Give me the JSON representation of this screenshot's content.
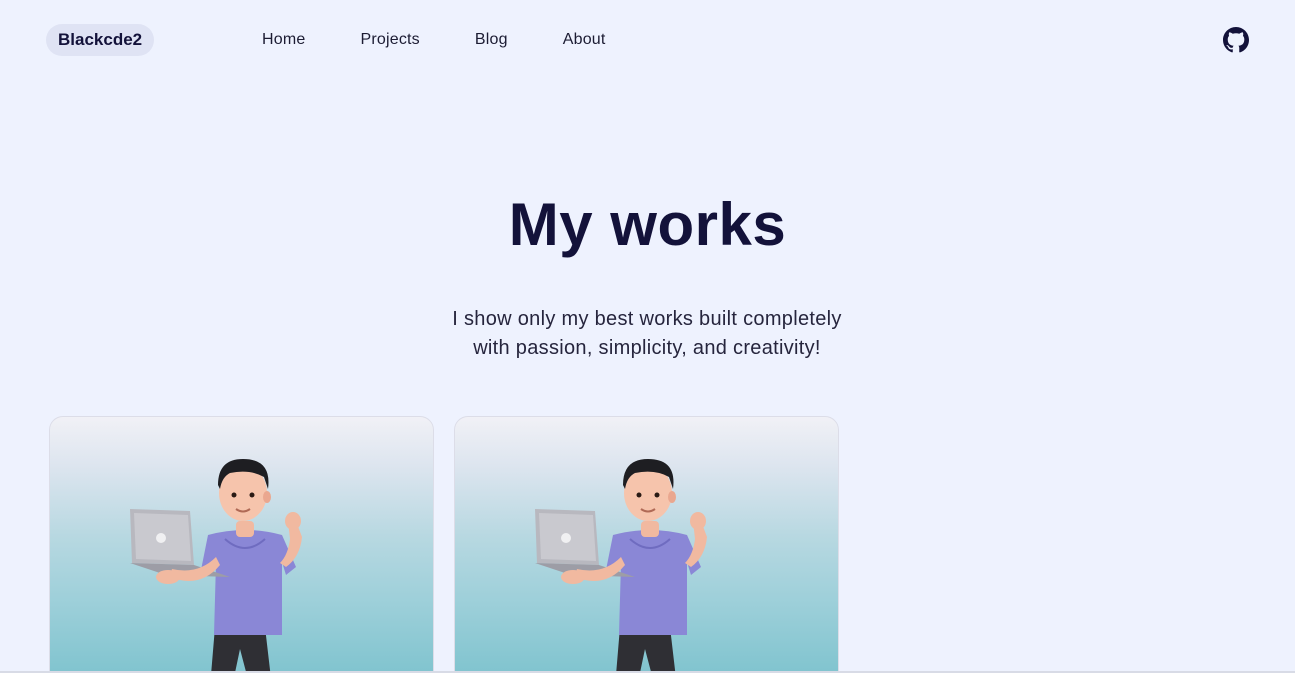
{
  "header": {
    "brand": "Blackcde2",
    "nav": [
      "Home",
      "Projects",
      "Blog",
      "About"
    ],
    "github_icon": "github-icon"
  },
  "hero": {
    "title": "My works",
    "subtitle_line1": "I show only my best works built completely",
    "subtitle_line2": "with passion, simplicity, and creativity!"
  },
  "projects": [
    {
      "image": "person-with-laptop-illustration"
    },
    {
      "image": "person-with-laptop-illustration"
    }
  ],
  "colors": {
    "background": "#eef2fe",
    "text_dark": "#13123a",
    "card_gradient_top": "#f1f1f6",
    "card_gradient_bottom": "#7cc2cd",
    "shirt": "#8a87d6"
  }
}
